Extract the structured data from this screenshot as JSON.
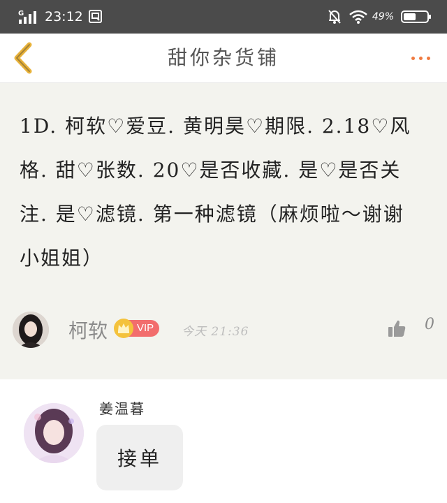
{
  "status_bar": {
    "network": "G",
    "time": "23:12",
    "battery_percent": "49%"
  },
  "nav": {
    "title": "甜你杂货铺"
  },
  "post": {
    "text": "1D. 柯软♡爱豆. 黄明昊♡期限. 2.18♡风格. 甜♡张数. 20♡是否收藏. 是♡是否关注. 是♡滤镜. 第一种滤镜（麻烦啦～谢谢小姐姐）",
    "author": "柯软",
    "badge": "VIP",
    "time": "今天  21:36",
    "likes": "0"
  },
  "comment": {
    "author": "姜温暮",
    "text": "接单"
  },
  "colors": {
    "status_bar_bg": "#4b4b4b",
    "accent": "#f07a3f",
    "vip_red": "#f26d6d",
    "post_bg": "#f3f3ee"
  },
  "icons": {
    "back": "chevron-left-icon",
    "more": "more-dots-icon",
    "like": "thumbs-up-icon",
    "crown": "crown-icon"
  }
}
